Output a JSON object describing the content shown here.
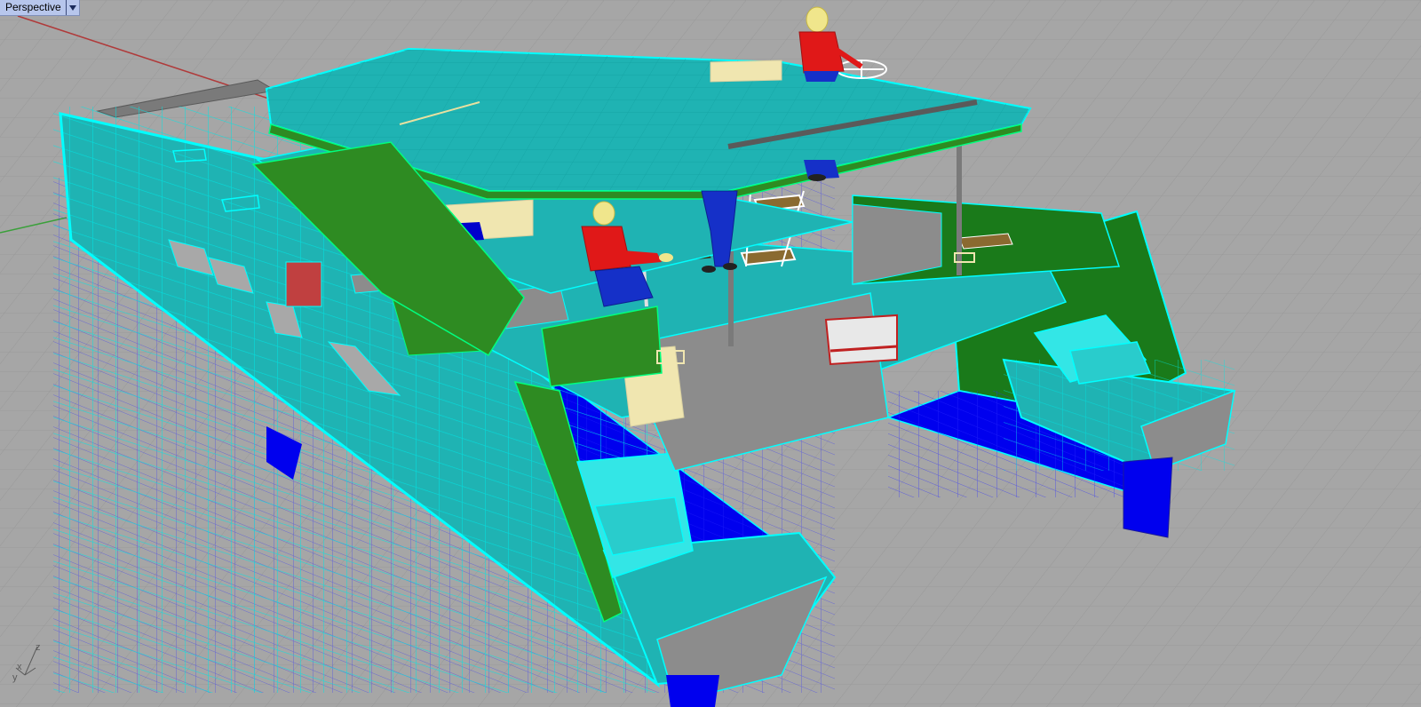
{
  "viewport": {
    "title": "Perspective",
    "menu_icon": "dropdown-arrow-icon"
  },
  "world_axes": {
    "x_label": "x",
    "y_label": "y",
    "z_label": "z"
  },
  "colors": {
    "background": "#a6a6a6",
    "grid": "#8f8f8f",
    "x_axis": "#b03a3a",
    "y_axis": "#3aa03a",
    "selection_wire": "#00ffff",
    "deck_fill": "#1fb3b3",
    "hull_bottom": "#0000ee",
    "transom": "#8c8c8c",
    "canopy_edge": "#2e8b22",
    "figure_shirt": "#e01818",
    "figure_pants": "#1530c8",
    "figure_head": "#f0e68c"
  }
}
